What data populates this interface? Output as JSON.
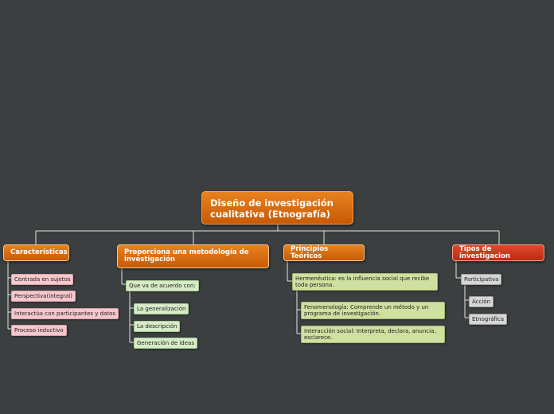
{
  "root": {
    "label": "Diseño de investigación cualitativa (Etnografía)"
  },
  "topics": {
    "caracteristicas": {
      "label": "Características",
      "items": [
        "Centrada en sujetos",
        "Perspectiva(integral)",
        "Interactúa con participantes y datos",
        "Proceso inductivo"
      ]
    },
    "metodologia": {
      "label": "Proporciona una metodología de investigación",
      "intermediate": "Que va de acuerdo con:",
      "items": [
        "La generalización",
        "La descripción",
        "Generación de ideas"
      ]
    },
    "principios": {
      "label": "Principios Teóricos",
      "intermediate": "Hermenéutica: es la influencia social que recibe toda persona.",
      "items": [
        "Fenomenología: Comprende un método y un programa de investigación.",
        "Interacción social: Interpreta, declara, anuncia, esclarece."
      ]
    },
    "tipos": {
      "label": "Tipos de investigacion",
      "intermediate": "Participativa",
      "items": [
        "Acción",
        "Etnográfica"
      ]
    }
  },
  "colors": {
    "background": "#3b3f3f",
    "connector": "#e6e6e6",
    "topic_orange": "#d96a10",
    "topic_red": "#cc3a1e",
    "leaf_pink": "#f6c7cd",
    "leaf_green": "#d6ebc6",
    "leaf_olive": "#cfe0a0",
    "leaf_grey": "#d6d6d6"
  }
}
